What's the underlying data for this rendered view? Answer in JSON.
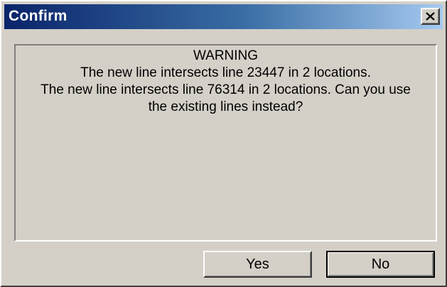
{
  "window": {
    "title": "Confirm",
    "close_icon": "close-icon"
  },
  "message": {
    "heading": "WARNING",
    "line1": "The new line intersects line 23447 in 2 locations.",
    "line2": "The new line intersects line 76314 in 2 locations. Can you use",
    "line3": "the existing lines instead?"
  },
  "buttons": {
    "yes_label": "Yes",
    "no_label": "No"
  },
  "colors": {
    "titlebar_start": "#0a246a",
    "titlebar_end": "#a6caf0",
    "face": "#d4d0c8"
  }
}
